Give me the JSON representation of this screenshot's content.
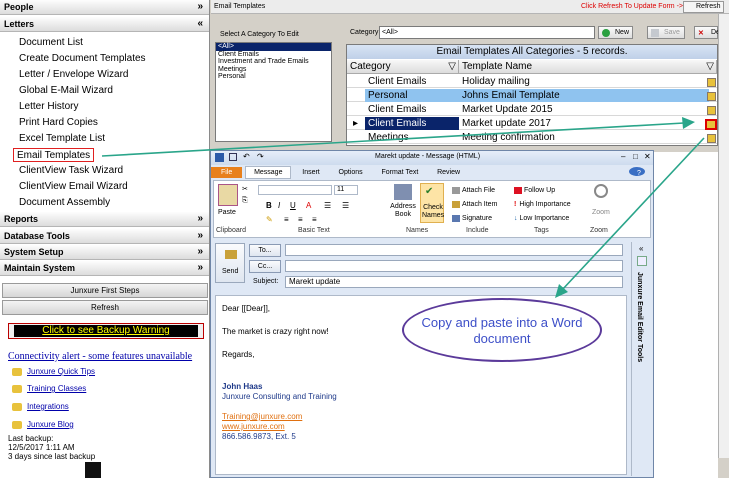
{
  "sidebar": {
    "headers": {
      "people": "People",
      "letters": "Letters",
      "reports": "Reports",
      "database_tools": "Database Tools",
      "system_setup": "System Setup",
      "maintain_system": "Maintain System"
    },
    "letters_items": [
      "Document List",
      "Create Document Templates",
      "Letter / Envelope Wizard",
      "Global E-Mail Wizard",
      "Letter History",
      "Print Hard Copies",
      "Excel Template List",
      "Email Templates",
      "ClientView Task Wizard",
      "ClientView Email Wizard",
      "Document Assembly"
    ],
    "first_steps": "Junxure First Steps",
    "refresh": "Refresh",
    "backup_warning": "Click to see Backup Warning",
    "connectivity": "Connectivity alert - some features unavailable",
    "links": [
      "Junxure Quick Tips",
      "Training Classes",
      "Integrations",
      "Junxure Blog"
    ],
    "last_backup_label": "Last backup:",
    "last_backup_date": "12/5/2017 1:11 AM",
    "days_since": "3 days since last backup"
  },
  "panel": {
    "title": "Email Templates",
    "refresh_note": "Click Refresh To Update Form ->",
    "refresh_btn": "Refresh",
    "select_category_label": "Select A Category To Edit",
    "categories": [
      "<All>",
      "Client Emails",
      "Investment and Trade Emails",
      "Meetings",
      "Personal"
    ],
    "category_label": "Category",
    "category_value": "<All>",
    "new_btn": "New",
    "save_btn": "Save",
    "del_btn": "De",
    "grid_title": "Email Templates All Categories - 5 records.",
    "col_category": "Category",
    "col_template": "Template Name",
    "rows": [
      {
        "category": "Client Emails",
        "name": "Holiday mailing"
      },
      {
        "category": "Personal",
        "name": "Johns Email Template"
      },
      {
        "category": "Client Emails",
        "name": "Market Update 2015"
      },
      {
        "category": "Client Emails",
        "name": "Market update 2017"
      },
      {
        "category": "Meetings",
        "name": "Meeting confirmation"
      }
    ]
  },
  "outlook": {
    "title": "Marekt update  -  Message (HTML)",
    "tabs": [
      "File",
      "Message",
      "Insert",
      "Options",
      "Format Text",
      "Review"
    ],
    "font_size": "11",
    "paste": "Paste",
    "groups": [
      "Clipboard",
      "Basic Text",
      "Names",
      "Include",
      "Tags",
      "Zoom"
    ],
    "address_book": "Address Book",
    "check_names": "Check Names",
    "attach_file": "Attach File",
    "attach_item": "Attach Item",
    "signature": "Signature",
    "follow_up": "Follow Up",
    "high_importance": "High Importance",
    "low_importance": "Low Importance",
    "zoom": "Zoom",
    "send": "Send",
    "to": "To...",
    "cc": "Cc...",
    "subject_label": "Subject:",
    "subject": "Marekt update",
    "side_pane": "Junxure Email Editor Tools",
    "body": {
      "greeting": "Dear [[Dear]],",
      "line1": "The market is crazy right now!",
      "regards": "Regards,",
      "name": "John Haas",
      "company": "Junxure Consulting and Training",
      "email": "Training@junxure.com",
      "web": "www.junxure.com",
      "phone": "866.586.9873, Ext. 5"
    }
  },
  "callout": "Copy and paste into a Word document"
}
